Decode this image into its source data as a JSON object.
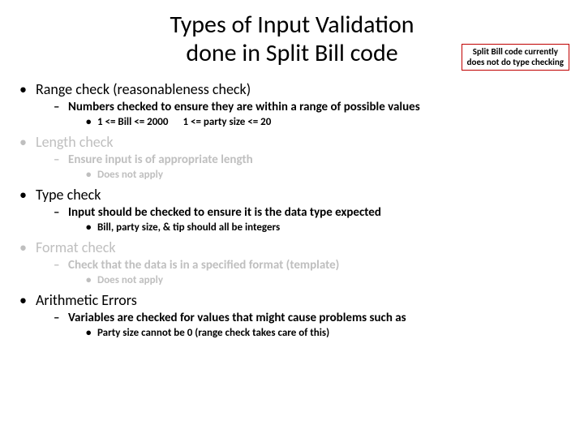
{
  "title_line1": "Types of Input Validation",
  "title_line2": "done in Split Bill code",
  "callout_line1": "Split Bill code currently",
  "callout_line2": "does not do type checking",
  "items": [
    {
      "text": "Range check (reasonableness check)",
      "dim": false,
      "sub": [
        {
          "text": "Numbers checked to ensure they are within a range of possible values",
          "dim": false,
          "sub": [
            {
              "text": "1 <= Bill <= 2000",
              "extra": "1 <= party size <= 20",
              "dim": false
            }
          ]
        }
      ]
    },
    {
      "text": "Length check",
      "dim": true,
      "sub": [
        {
          "text": "Ensure input is of appropriate length",
          "dim": true,
          "sub": [
            {
              "text": "Does not apply",
              "dim": true
            }
          ]
        }
      ]
    },
    {
      "text": "Type check",
      "dim": false,
      "sub": [
        {
          "text": "Input should be checked to ensure it is the data type expected",
          "dim": false,
          "sub": [
            {
              "text": "Bill, party size, & tip should all be integers",
              "dim": false
            }
          ]
        }
      ]
    },
    {
      "text": "Format check",
      "dim": true,
      "sub": [
        {
          "text": "Check that the data is in a specified format (template)",
          "dim": true,
          "sub": [
            {
              "text": "Does not apply",
              "dim": true
            }
          ]
        }
      ]
    },
    {
      "text": "Arithmetic Errors",
      "dim": false,
      "sub": [
        {
          "text": "Variables are checked for values that might cause problems such as",
          "dim": false,
          "sub": [
            {
              "text": "Party size cannot be 0 (range check takes care of this)",
              "dim": false
            }
          ]
        }
      ]
    }
  ]
}
